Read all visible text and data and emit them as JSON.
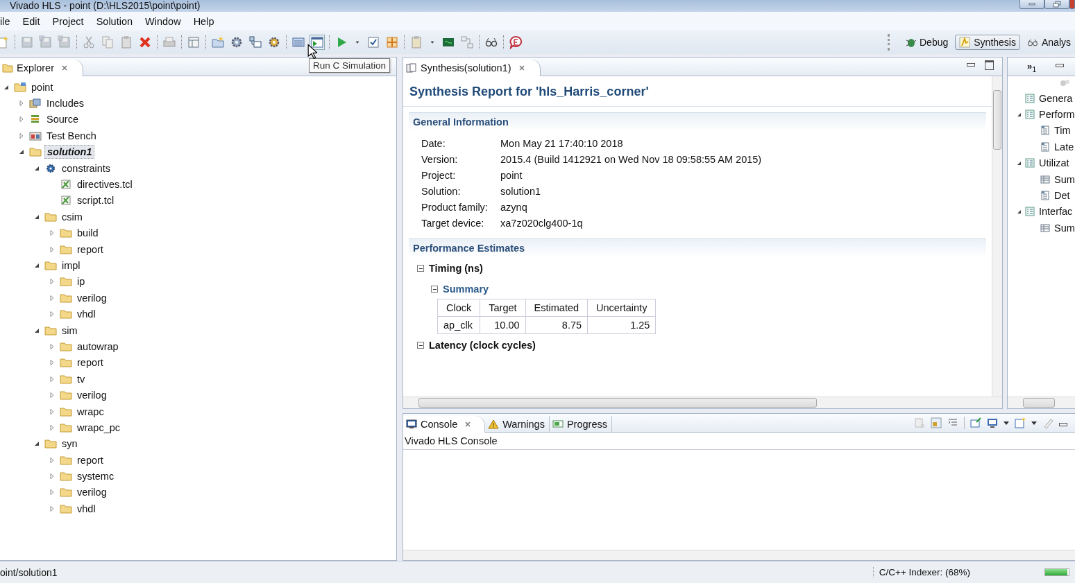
{
  "window": {
    "title": "Vivado HLS - point (D:\\HLS2015\\point\\point)"
  },
  "menu": [
    "ile",
    "Edit",
    "Project",
    "Solution",
    "Window",
    "Help"
  ],
  "toolbar": {
    "tooltip": "Run C Simulation"
  },
  "perspectives": [
    {
      "label": "Debug",
      "kind": "debug",
      "selected": false
    },
    {
      "label": "Synthesis",
      "kind": "synthesis",
      "selected": true
    },
    {
      "label": "Analys",
      "kind": "analysis",
      "selected": false
    }
  ],
  "explorer": {
    "tab": "Explorer",
    "tree": [
      {
        "label": "point",
        "kind": "project",
        "expanded": true,
        "selected": false,
        "children": [
          {
            "label": "Includes",
            "kind": "includes",
            "expanded": false,
            "selected": false
          },
          {
            "label": "Source",
            "kind": "source",
            "expanded": false,
            "selected": false
          },
          {
            "label": "Test Bench",
            "kind": "testbench",
            "expanded": false,
            "selected": false
          },
          {
            "label": "solution1",
            "kind": "solution",
            "expanded": true,
            "selected": true,
            "children": [
              {
                "label": "constraints",
                "kind": "constraints",
                "expanded": true,
                "selected": false,
                "children": [
                  {
                    "label": "directives.tcl",
                    "kind": "tcl",
                    "selected": false
                  },
                  {
                    "label": "script.tcl",
                    "kind": "tcl",
                    "selected": false
                  }
                ]
              },
              {
                "label": "csim",
                "kind": "folder",
                "expanded": true,
                "selected": false,
                "children": [
                  {
                    "label": "build",
                    "kind": "folder",
                    "expanded": false,
                    "selected": false
                  },
                  {
                    "label": "report",
                    "kind": "folder",
                    "expanded": false,
                    "selected": false
                  }
                ]
              },
              {
                "label": "impl",
                "kind": "folder",
                "expanded": true,
                "selected": false,
                "children": [
                  {
                    "label": "ip",
                    "kind": "folder",
                    "expanded": false,
                    "selected": false
                  },
                  {
                    "label": "verilog",
                    "kind": "folder",
                    "expanded": false,
                    "selected": false
                  },
                  {
                    "label": "vhdl",
                    "kind": "folder",
                    "expanded": false,
                    "selected": false
                  }
                ]
              },
              {
                "label": "sim",
                "kind": "folder",
                "expanded": true,
                "selected": false,
                "children": [
                  {
                    "label": "autowrap",
                    "kind": "folder",
                    "expanded": false,
                    "selected": false
                  },
                  {
                    "label": "report",
                    "kind": "folder",
                    "expanded": false,
                    "selected": false
                  },
                  {
                    "label": "tv",
                    "kind": "folder",
                    "expanded": false,
                    "selected": false
                  },
                  {
                    "label": "verilog",
                    "kind": "folder",
                    "expanded": false,
                    "selected": false
                  },
                  {
                    "label": "wrapc",
                    "kind": "folder",
                    "expanded": false,
                    "selected": false
                  },
                  {
                    "label": "wrapc_pc",
                    "kind": "folder",
                    "expanded": false,
                    "selected": false
                  }
                ]
              },
              {
                "label": "syn",
                "kind": "folder",
                "expanded": true,
                "selected": false,
                "children": [
                  {
                    "label": "report",
                    "kind": "folder",
                    "expanded": false,
                    "selected": false
                  },
                  {
                    "label": "systemc",
                    "kind": "folder",
                    "expanded": false,
                    "selected": false
                  },
                  {
                    "label": "verilog",
                    "kind": "folder",
                    "expanded": false,
                    "selected": false
                  },
                  {
                    "label": "vhdl",
                    "kind": "folder",
                    "expanded": false,
                    "selected": false
                  }
                ]
              }
            ]
          }
        ]
      }
    ]
  },
  "report": {
    "tab": "Synthesis(solution1)",
    "title": "Synthesis Report for 'hls_Harris_corner'",
    "general": {
      "heading": "General Information",
      "fields": [
        {
          "label": "Date:",
          "value": "Mon May 21 17:40:10 2018"
        },
        {
          "label": "Version:",
          "value": "2015.4 (Build 1412921 on Wed Nov 18 09:58:55 AM 2015)"
        },
        {
          "label": "Project:",
          "value": "point"
        },
        {
          "label": "Solution:",
          "value": "solution1"
        },
        {
          "label": "Product family:",
          "value": "azynq"
        },
        {
          "label": "Target device:",
          "value": "xa7z020clg400-1q"
        }
      ]
    },
    "performance": {
      "heading": "Performance Estimates",
      "timing": {
        "title": "Timing (ns)",
        "expanded": true,
        "summary": {
          "title": "Summary",
          "expanded": true,
          "columns": [
            "Clock",
            "Target",
            "Estimated",
            "Uncertainty"
          ],
          "rows": [
            [
              "ap_clk",
              "10.00",
              "8.75",
              "1.25"
            ]
          ]
        }
      },
      "latency": {
        "title": "Latency (clock cycles)",
        "expanded": true
      }
    }
  },
  "outline": {
    "overflow": "»",
    "count": "1",
    "items": [
      {
        "label": "Genera",
        "kind": "section"
      },
      {
        "label": "Perform",
        "kind": "section",
        "expanded": true,
        "children": [
          {
            "label": "Tim",
            "kind": "detail"
          },
          {
            "label": "Late",
            "kind": "detail"
          }
        ]
      },
      {
        "label": "Utilizat",
        "kind": "section",
        "expanded": true,
        "children": [
          {
            "label": "Sum",
            "kind": "table"
          },
          {
            "label": "Det",
            "kind": "detail"
          }
        ]
      },
      {
        "label": "Interfac",
        "kind": "section",
        "expanded": true,
        "children": [
          {
            "label": "Sum",
            "kind": "table"
          }
        ]
      }
    ]
  },
  "console": {
    "tabs": [
      {
        "label": "Console",
        "kind": "console",
        "selected": true
      },
      {
        "label": "Warnings",
        "kind": "warnings",
        "selected": false
      },
      {
        "label": "Progress",
        "kind": "progress",
        "selected": false
      }
    ],
    "title": "Vivado HLS Console"
  },
  "status_bar": {
    "path": "oint/solution1",
    "indexer": "C/C++ Indexer: (68%)",
    "level": 0.95
  }
}
